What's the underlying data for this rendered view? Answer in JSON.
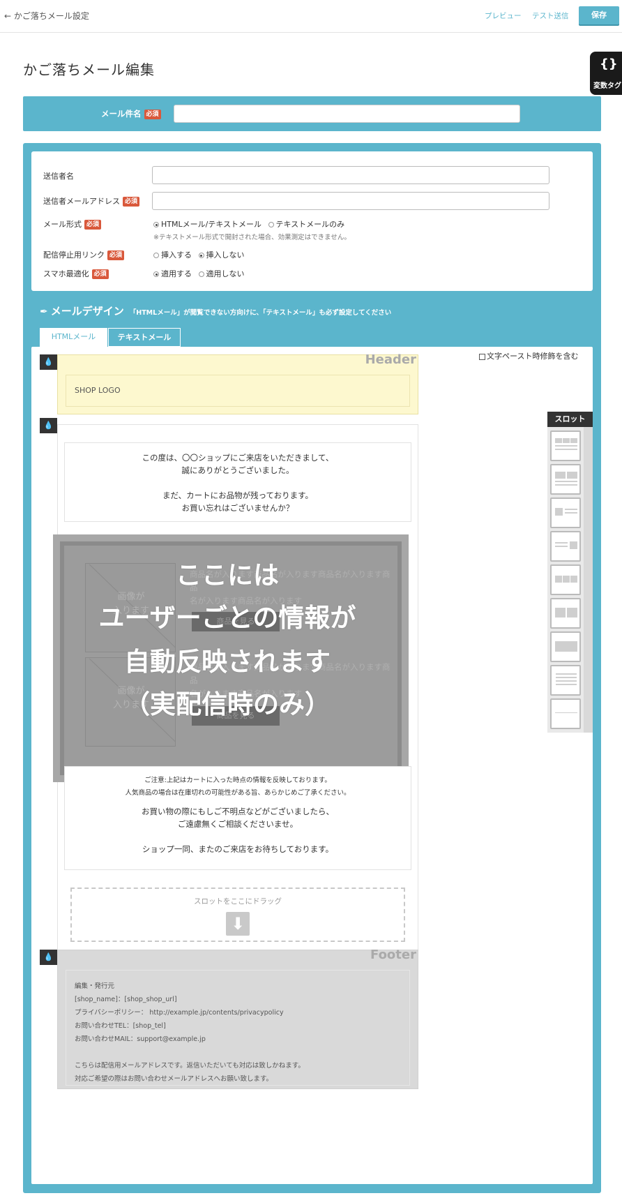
{
  "topbar": {
    "back_label": "← かご落ちメール設定",
    "preview_label": "プレビュー",
    "test_send_label": "テスト送信",
    "save_label": "保存"
  },
  "page_title": "かご落ちメール編集",
  "variable_tag": {
    "icon": "braces-icon",
    "label": "変数タグ"
  },
  "required_badge": "必須",
  "subject": {
    "label": "メール件名",
    "value": ""
  },
  "settings": {
    "sender_name_label": "送信者名",
    "sender_name_value": "",
    "sender_email_label": "送信者メールアドレス",
    "sender_email_value": "",
    "mail_format_label": "メール形式",
    "mail_format_options": [
      "HTMLメール/テキストメール",
      "テキストメールのみ"
    ],
    "mail_format_selected": "HTMLメール/テキストメール",
    "mail_format_note": "※テキストメール形式で開封された場合、効果測定はできません。",
    "unsubscribe_label": "配信停止用リンク",
    "unsubscribe_options": [
      "挿入する",
      "挿入しない"
    ],
    "unsubscribe_selected": "挿入しない",
    "smartphone_label": "スマホ最適化",
    "smartphone_options": [
      "適用する",
      "適用しない"
    ],
    "smartphone_selected": "適用する"
  },
  "design": {
    "title": "メールデザイン",
    "hint": "「HTMLメール」が閲覧できない方向けに、「テキストメール」も必ず設定してください",
    "tabs": [
      "HTMLメール",
      "テキストメール"
    ],
    "active_tab": "HTMLメール",
    "paste_option_label": "文字ペースト時修飾を含む",
    "paste_option_checked": false
  },
  "header_block": {
    "tag": "Header",
    "logo_text": "SHOP LOGO"
  },
  "body_block": {
    "greeting": [
      "この度は、〇〇ショップにご来店をいただきまして、",
      "誠にありがとうございました。",
      "",
      "まだ、カートにお品物が残っております。",
      "お買い忘れはございませんか？"
    ],
    "products": [
      {
        "image_caption": [
          "画像が",
          "入ります"
        ],
        "name_lines": [
          "商品名が入ります商品名が入ります商品名が入ります商品",
          "名が入ります商品名が入ります"
        ],
        "button": "商品を見る"
      },
      {
        "image_caption": [
          "画像が",
          "入ります"
        ],
        "name_lines": [
          "商品名が入ります商品名が入ります商品名が入ります商品",
          "名が入ります商品名が入ります"
        ],
        "button": "商品を見る"
      }
    ],
    "overlay_lines": [
      "ここには",
      "ユーザーごとの情報が",
      "自動反映されます",
      "（実配信時のみ）"
    ],
    "notice_small": [
      "ご注意:上記はカートに入った時点の情報を反映しております。",
      "人気商品の場合は在庫切れの可能性がある旨、あらかじめご了承ください。"
    ],
    "notice_main": [
      "お買い物の際にもしご不明点などがございましたら、",
      "ご遠慮無くご相談くださいませ。",
      "",
      "ショップ一同、またのご来店をお待ちしております。"
    ],
    "slot_drop_label": "スロットをここにドラッグ"
  },
  "footer_block": {
    "tag": "Footer",
    "lines": [
      "編集・発行元",
      "[shop_name]：[shop_shop_url]",
      "プライバシーポリシー： http://example.jp/contents/privacypolicy",
      "お問い合わせTEL：[shop_tel]",
      "お問い合わせMAIL：support@example.jp",
      "",
      "こちらは配信用メールアドレスです。返信いただいても対応は致しかねます。",
      "対応ご希望の際はお問い合わせメールアドレスへお願い致します。"
    ]
  },
  "slot_panel": {
    "title": "スロット",
    "items": [
      "slot-grid-icon",
      "slot-two-column-icon",
      "slot-image-left-icon",
      "slot-image-right-icon",
      "slot-three-column-icon",
      "slot-two-block-icon",
      "slot-banner-icon",
      "slot-text-icon",
      "slot-divider-icon"
    ]
  },
  "colors": {
    "accent": "#5bb5cc",
    "required": "#d9583b",
    "header_bg": "#fdf8cf",
    "footer_bg": "#d9d9d9"
  }
}
